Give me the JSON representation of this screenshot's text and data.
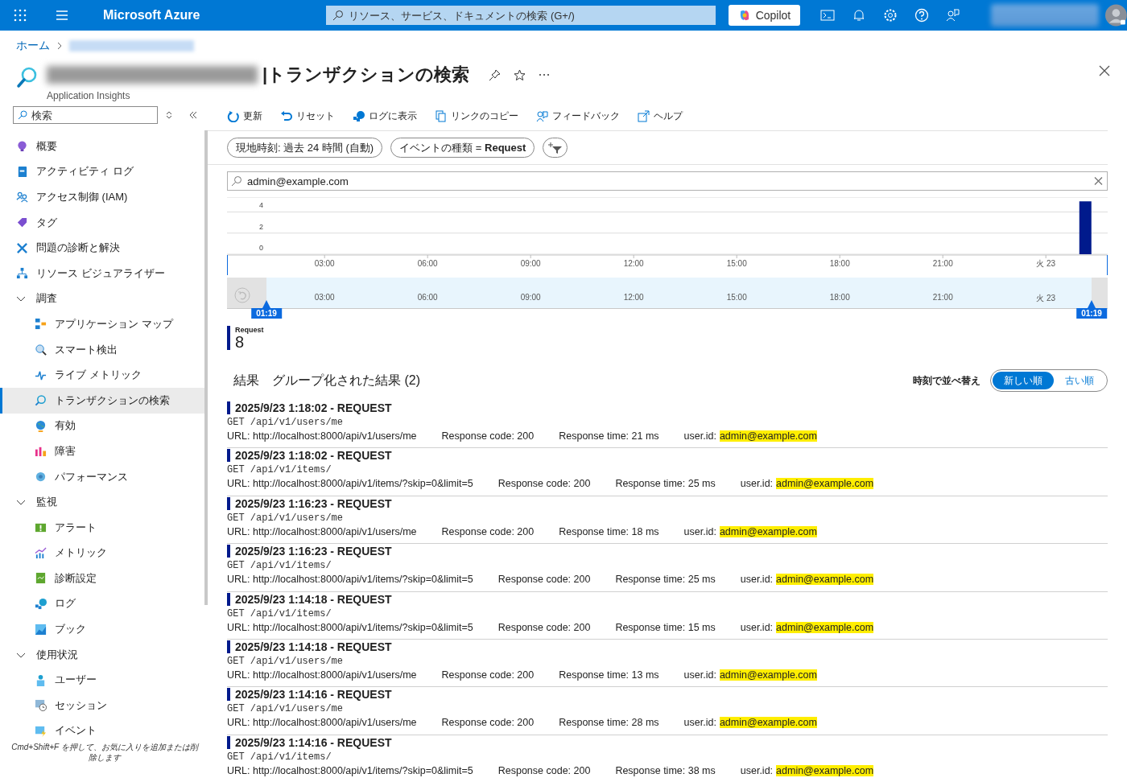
{
  "topbar": {
    "brand": "Microsoft Azure",
    "search": {
      "placeholder": "リソース、サービス、ドキュメントの検索 (G+/)"
    },
    "copilot": "Copilot"
  },
  "breadcrumb": [
    {
      "label": "ホーム"
    }
  ],
  "page": {
    "title": "|トランザクションの検索",
    "subtitle": "Application Insights"
  },
  "sidebar": {
    "search": {
      "placeholder": "検索"
    },
    "items": [
      {
        "kind": "item",
        "label": "概要",
        "selected": false
      },
      {
        "kind": "item",
        "label": "アクティビティ ログ",
        "selected": false
      },
      {
        "kind": "item",
        "label": "アクセス制御 (IAM)",
        "selected": false
      },
      {
        "kind": "item",
        "label": "タグ",
        "selected": false
      },
      {
        "kind": "item",
        "label": "問題の診断と解決",
        "selected": false
      },
      {
        "kind": "item",
        "label": "リソース ビジュアライザー",
        "selected": false
      },
      {
        "kind": "group",
        "label": "調査",
        "expanded": true,
        "children": [
          {
            "kind": "item",
            "label": "アプリケーション マップ",
            "selected": false
          },
          {
            "kind": "item",
            "label": "スマート検出",
            "selected": false
          },
          {
            "kind": "item",
            "label": "ライブ メトリック",
            "selected": false
          },
          {
            "kind": "item",
            "label": "トランザクションの検索",
            "selected": true
          },
          {
            "kind": "item",
            "label": "有効",
            "selected": false
          },
          {
            "kind": "item",
            "label": "障害",
            "selected": false
          },
          {
            "kind": "item",
            "label": "パフォーマンス",
            "selected": false
          }
        ]
      },
      {
        "kind": "group",
        "label": "監視",
        "expanded": true,
        "children": [
          {
            "kind": "item",
            "label": "アラート",
            "selected": false
          },
          {
            "kind": "item",
            "label": "メトリック",
            "selected": false
          },
          {
            "kind": "item",
            "label": "診断設定",
            "selected": false
          },
          {
            "kind": "item",
            "label": "ログ",
            "selected": false
          },
          {
            "kind": "item",
            "label": "ブック",
            "selected": false
          }
        ]
      },
      {
        "kind": "group",
        "label": "使用状況",
        "expanded": true,
        "children": [
          {
            "kind": "item",
            "label": "ユーザー",
            "selected": false
          },
          {
            "kind": "item",
            "label": "セッション",
            "selected": false
          },
          {
            "kind": "item",
            "label": "イベント",
            "selected": false
          }
        ]
      }
    ],
    "hint": "Cmd+Shift+F を押して、お気に入りを追加または削除します"
  },
  "toolbar": [
    {
      "label": "更新"
    },
    {
      "label": "リセット"
    },
    {
      "label": "ログに表示"
    },
    {
      "label": "リンクのコピー"
    },
    {
      "label": "フィードバック"
    },
    {
      "label": "ヘルプ"
    }
  ],
  "filters": [
    {
      "label": "現地時刻: 過去 24 時間 (自動)"
    },
    {
      "label": "イベントの種類 = **Request**"
    }
  ],
  "search": {
    "value": "admin@example.com"
  },
  "chart": {
    "chart_data": {
      "type": "bar",
      "x": [
        25.15
      ],
      "series": [
        {
          "name": "Request",
          "color": "#001a8c",
          "values": [
            5
          ]
        }
      ],
      "xlim": [
        0.16,
        25.8
      ],
      "ylim": [
        0,
        5.4
      ],
      "yticks": [
        0,
        2,
        4
      ],
      "xticks": [
        {
          "value": 3,
          "label": "03:00"
        },
        {
          "value": 6,
          "label": "06:00"
        },
        {
          "value": 9,
          "label": "09:00"
        },
        {
          "value": 12,
          "label": "12:00"
        },
        {
          "value": 15,
          "label": "15:00"
        },
        {
          "value": 18,
          "label": "18:00"
        },
        {
          "value": 21,
          "label": "21:00"
        },
        {
          "value": 24,
          "label": "火 23"
        }
      ]
    }
  },
  "navigator": {
    "ticks": [
      "03:00",
      "06:00",
      "09:00",
      "12:00",
      "15:00",
      "18:00",
      "21:00",
      "火 23"
    ],
    "start": "01:19",
    "end": "01:19"
  },
  "legend": {
    "count": "8"
  },
  "results": {
    "headings": [
      {
        "label": "結果"
      },
      {
        "label": "グループ化された結果 (2)"
      }
    ],
    "sort_label": "時刻で並べ替え",
    "sort_options": [
      {
        "label": "新しい順",
        "selected": true
      },
      {
        "label": "古い順",
        "selected": false
      }
    ]
  },
  "rows": [
    {
      "title": "2025/9/23 1:18:02 - REQUEST",
      "path": "GET /api/v1/users/me",
      "url": "URL: http://localhost:8000/api/v1/users/me",
      "code": "Response code: 200",
      "time": "Response time: 21 ms",
      "user_label": "user.id:",
      "user": "admin@example.com",
      "highlighted": true
    },
    {
      "title": "2025/9/23 1:18:02 - REQUEST",
      "path": "GET /api/v1/items/",
      "url": "URL: http://localhost:8000/api/v1/items/?skip=0&limit=5",
      "code": "Response code: 200",
      "time": "Response time: 25 ms",
      "user_label": "user.id:",
      "user": "admin@example.com",
      "highlighted": true
    },
    {
      "title": "2025/9/23 1:16:23 - REQUEST",
      "path": "GET /api/v1/users/me",
      "url": "URL: http://localhost:8000/api/v1/users/me",
      "code": "Response code: 200",
      "time": "Response time: 18 ms",
      "user_label": "user.id:",
      "user": "admin@example.com",
      "highlighted": true
    },
    {
      "title": "2025/9/23 1:16:23 - REQUEST",
      "path": "GET /api/v1/items/",
      "url": "URL: http://localhost:8000/api/v1/items/?skip=0&limit=5",
      "code": "Response code: 200",
      "time": "Response time: 25 ms",
      "user_label": "user.id:",
      "user": "admin@example.com",
      "highlighted": true
    },
    {
      "title": "2025/9/23 1:14:18 - REQUEST",
      "path": "GET /api/v1/items/",
      "url": "URL: http://localhost:8000/api/v1/items/?skip=0&limit=5",
      "code": "Response code: 200",
      "time": "Response time: 15 ms",
      "user_label": "user.id:",
      "user": "admin@example.com",
      "highlighted": true
    },
    {
      "title": "2025/9/23 1:14:18 - REQUEST",
      "path": "GET /api/v1/users/me",
      "url": "URL: http://localhost:8000/api/v1/users/me",
      "code": "Response code: 200",
      "time": "Response time: 13 ms",
      "user_label": "user.id:",
      "user": "admin@example.com",
      "highlighted": true
    },
    {
      "title": "2025/9/23 1:14:16 - REQUEST",
      "path": "GET /api/v1/users/me",
      "url": "URL: http://localhost:8000/api/v1/users/me",
      "code": "Response code: 200",
      "time": "Response time: 28 ms",
      "user_label": "user.id:",
      "user": "admin@example.com",
      "highlighted": true
    },
    {
      "title": "2025/9/23 1:14:16 - REQUEST",
      "path": "GET /api/v1/items/",
      "url": "URL: http://localhost:8000/api/v1/items/?skip=0&limit=5",
      "code": "Response code: 200",
      "time": "Response time: 38 ms",
      "user_label": "user.id:",
      "user": "admin@example.com",
      "highlighted": true
    }
  ]
}
